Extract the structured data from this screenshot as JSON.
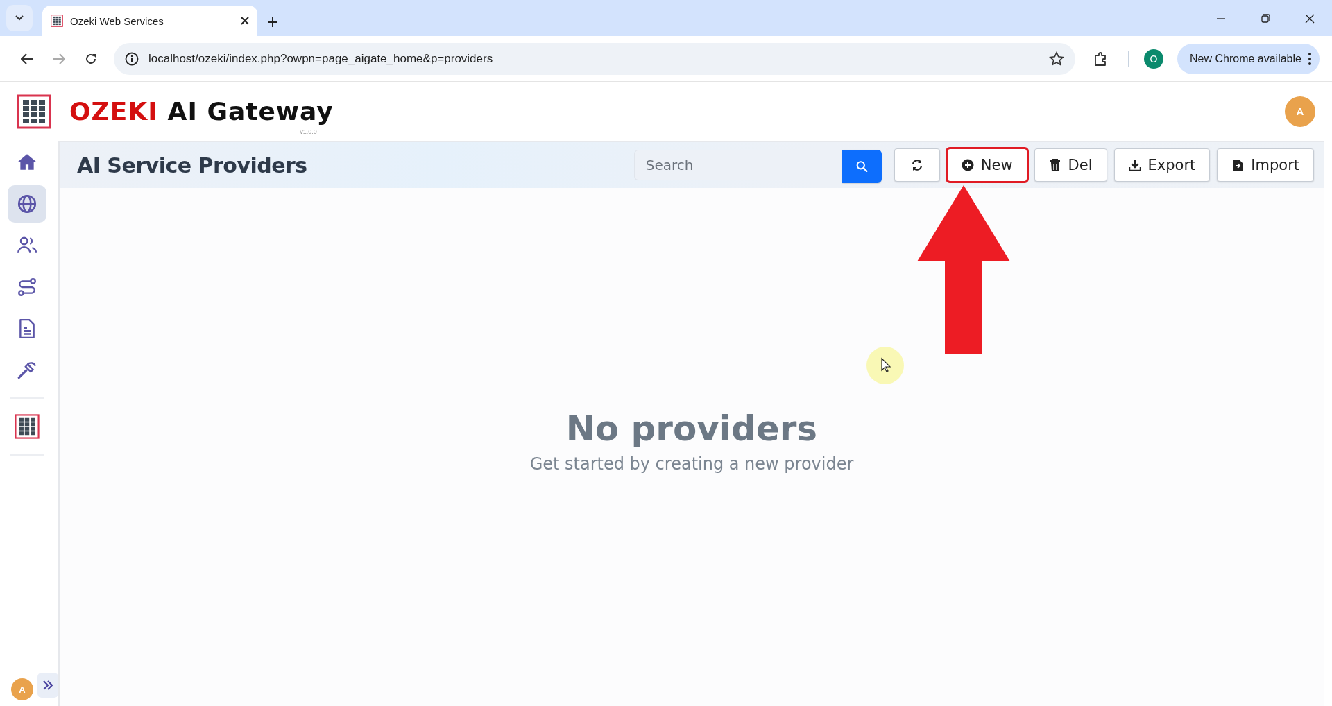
{
  "browser": {
    "tab_title": "Ozeki Web Services",
    "url": "localhost/ozeki/index.php?owpn=page_aigate_home&p=providers",
    "profile": "O",
    "update_label": "New Chrome available"
  },
  "app": {
    "brand": "OZEKI",
    "product": "AI Gateway",
    "version": "v1.0.0",
    "user_avatar": "A"
  },
  "sidebar": {
    "items": [
      {
        "kind": "home",
        "selected": false
      },
      {
        "kind": "globe",
        "selected": true
      },
      {
        "kind": "users",
        "selected": false
      },
      {
        "kind": "route",
        "selected": false
      },
      {
        "kind": "document",
        "selected": false
      },
      {
        "kind": "hammer",
        "selected": false
      },
      {
        "kind": "logo",
        "selected": false
      }
    ],
    "user_avatar": "A"
  },
  "page": {
    "title": "AI Service Providers",
    "search": {
      "placeholder": "Search"
    },
    "buttons": [
      {
        "kind": "refresh",
        "highlighted": false
      },
      {
        "kind": "new",
        "label": "New",
        "highlighted": true
      },
      {
        "kind": "delete",
        "label": "Del",
        "highlighted": false
      },
      {
        "kind": "export",
        "label": "Export",
        "highlighted": false
      },
      {
        "kind": "import",
        "label": "Import",
        "highlighted": false
      }
    ],
    "empty_title": "No providers",
    "empty_subtitle": "Get started by creating a new provider"
  }
}
